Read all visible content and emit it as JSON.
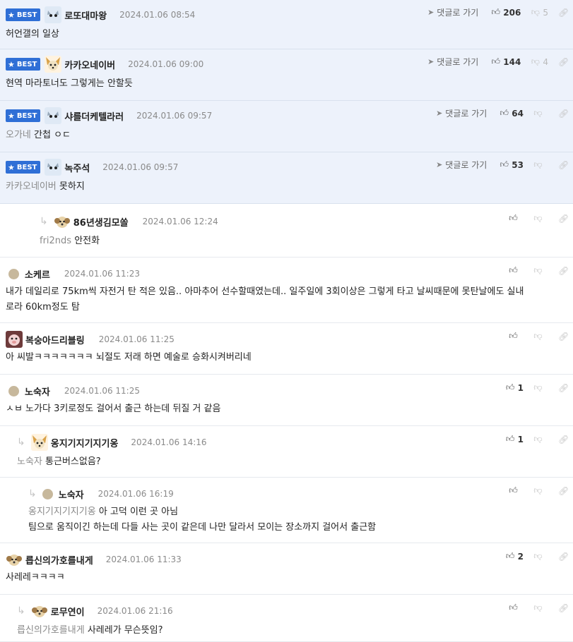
{
  "ui": {
    "best_label": "BEST",
    "jump_label": "댓글로 가기",
    "reply_arrow": "↳"
  },
  "comments": [
    {
      "best": true,
      "name": "로또대마왕",
      "date": "2024.01.06 08:54",
      "ref": "",
      "text": "허언갤의 일상",
      "up": "206",
      "down": "5",
      "avatar": "cat"
    },
    {
      "best": true,
      "name": "카카오네이버",
      "date": "2024.01.06 09:00",
      "ref": "",
      "text": "현역 마라토너도 그렇게는 안할듯",
      "up": "144",
      "down": "4",
      "avatar": "fox"
    },
    {
      "best": true,
      "name": "샤를더케텔라러",
      "date": "2024.01.06 09:57",
      "ref": "오가네",
      "text": "간첩 ㅇㄷ",
      "up": "64",
      "down": "",
      "avatar": "cat"
    },
    {
      "best": true,
      "name": "녹주석",
      "date": "2024.01.06 09:57",
      "ref": "카카오네이버",
      "text": "못하지",
      "up": "53",
      "down": "",
      "avatar": "cat"
    },
    {
      "best": false,
      "name": "86년생김모쏠",
      "date": "2024.01.06 12:24",
      "ref": "fri2nds",
      "text": "안전화",
      "up": "",
      "down": "",
      "avatar": "dog"
    },
    {
      "best": false,
      "name": "소케르",
      "date": "2024.01.06 11:23",
      "ref": "",
      "text": "내가 데일리로 75km씩 자전거 탄 적은 있음.. 아마추어 선수할때였는데.. 일주일에 3회이상은 그렇게 타고 날씨때문에 못탄날에도 실내",
      "text2": "로라 60km정도 탐",
      "up": "",
      "down": "",
      "avatar": "dot"
    },
    {
      "best": false,
      "name": "복숭아드리블링",
      "date": "2024.01.06 11:25",
      "ref": "",
      "text": "아 씨발ㅋㅋㅋㅋㅋㅋㅋ 뇌절도 저래 하면 예술로 승화시켜버리네",
      "up": "",
      "down": "",
      "avatar": "pig"
    },
    {
      "best": false,
      "name": "노숙자",
      "date": "2024.01.06 11:25",
      "ref": "",
      "text": "ㅅㅂ 노가다 3키로정도 걸어서 출근 하는데 뒤질 거 같음",
      "up": "1",
      "down": "",
      "avatar": "dot"
    },
    {
      "best": false,
      "name": "옹지기지기지기옹",
      "date": "2024.01.06 14:16",
      "ref": "노숙자",
      "text": "통근버스없음?",
      "up": "1",
      "down": "",
      "avatar": "fox"
    },
    {
      "best": false,
      "name": "노숙자",
      "date": "2024.01.06 16:19",
      "ref": "옹지기지기지기옹",
      "text": "아 고덕 이런 곳 아님",
      "text2": "팀으로 움직이긴 하는데 다들 사는 곳이 같은데 나만 달라서 모이는 장소까지 걸어서 출근함",
      "up": "",
      "down": "",
      "avatar": "dot"
    },
    {
      "best": false,
      "name": "릅신의가호를내게",
      "date": "2024.01.06 11:33",
      "ref": "",
      "text": "사레레ㅋㅋㅋㅋ",
      "up": "2",
      "down": "",
      "avatar": "dog"
    },
    {
      "best": false,
      "name": "로무연이",
      "date": "2024.01.06 21:16",
      "ref": "릅신의가호를내게",
      "text": "사레레가 무슨뜻임?",
      "up": "",
      "down": "",
      "avatar": "dog"
    }
  ]
}
